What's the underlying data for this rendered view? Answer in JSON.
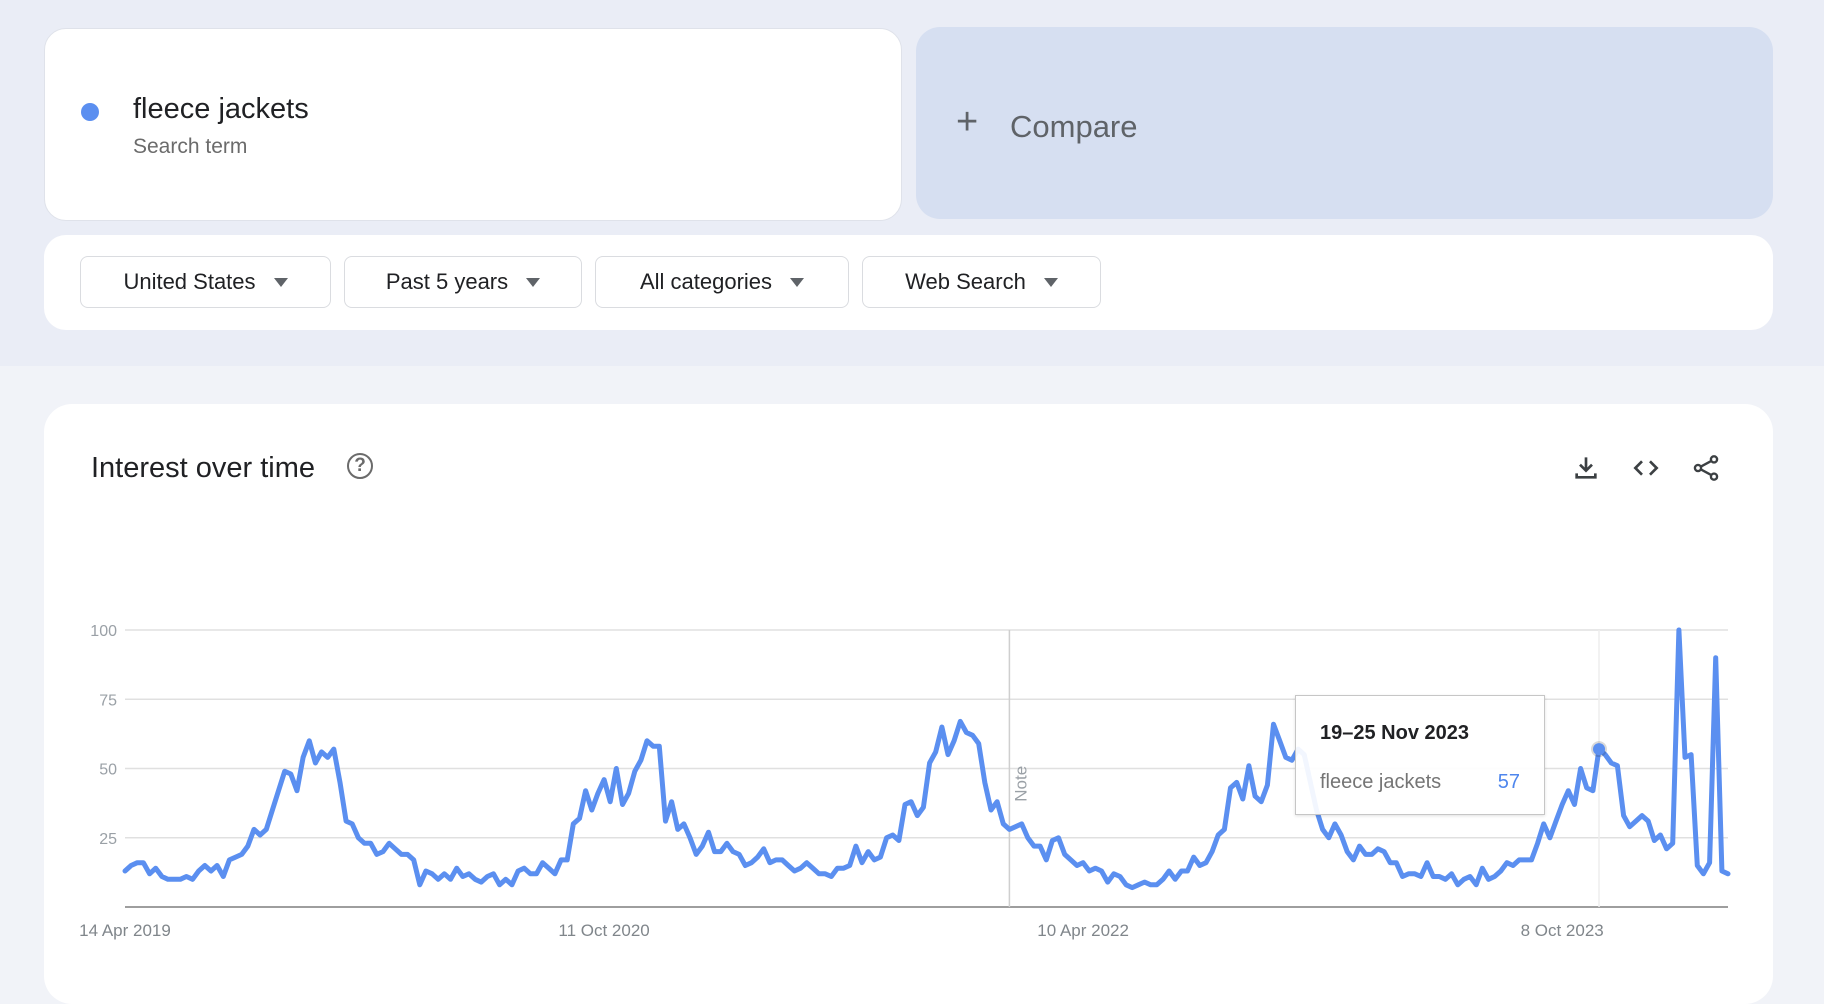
{
  "search": {
    "term": "fleece jackets",
    "term_type": "Search term",
    "term_color": "#5b8ff0",
    "compare_icon": "plus-icon",
    "compare_label": "Compare"
  },
  "filters": [
    {
      "label": "United States",
      "icon": "caret-down-icon"
    },
    {
      "label": "Past 5 years",
      "icon": "caret-down-icon"
    },
    {
      "label": "All categories",
      "icon": "caret-down-icon"
    },
    {
      "label": "Web Search",
      "icon": "caret-down-icon"
    }
  ],
  "widget": {
    "title": "Interest over time",
    "help_icon": "?",
    "tools": [
      "download-icon",
      "embed-code-icon",
      "share-icon"
    ]
  },
  "tooltip": {
    "date": "19–25 Nov 2023",
    "term": "fleece jackets",
    "value": "57"
  },
  "chart_data": {
    "type": "line",
    "title": "Interest over time",
    "xlabel": "",
    "ylabel": "",
    "ylim": [
      0,
      100
    ],
    "y_ticks": [
      100,
      75,
      50,
      25
    ],
    "x_tick_labels": [
      {
        "label": "14 Apr 2019",
        "week": 0
      },
      {
        "label": "11 Oct 2020",
        "week": 78
      },
      {
        "label": "10 Apr 2022",
        "week": 156
      },
      {
        "label": "8 Oct 2023",
        "week": 234
      }
    ],
    "grid": true,
    "legend": "none",
    "annotations": [
      {
        "label": "Note",
        "week": 144
      }
    ],
    "highlight": {
      "week": 240,
      "label": "19–25 Nov 2023",
      "value": 57
    },
    "line_color": "#5b8ff0",
    "series": [
      {
        "name": "fleece jackets",
        "values": [
          13,
          15,
          16,
          16,
          12,
          14,
          11,
          10,
          10,
          10,
          11,
          10,
          13,
          15,
          13,
          15,
          11,
          17,
          18,
          19,
          22,
          28,
          26,
          28,
          35,
          42,
          49,
          48,
          42,
          54,
          60,
          52,
          56,
          54,
          57,
          45,
          31,
          30,
          25,
          23,
          23,
          19,
          20,
          23,
          21,
          19,
          19,
          17,
          8,
          13,
          12,
          10,
          12,
          10,
          14,
          11,
          12,
          10,
          9,
          11,
          12,
          8,
          10,
          8,
          13,
          14,
          12,
          12,
          16,
          14,
          12,
          17,
          17,
          30,
          32,
          42,
          35,
          41,
          46,
          38,
          50,
          37,
          41,
          49,
          53,
          60,
          58,
          58,
          31,
          38,
          28,
          30,
          25,
          19,
          22,
          27,
          20,
          20,
          23,
          20,
          19,
          15,
          16,
          18,
          21,
          16,
          17,
          17,
          15,
          13,
          14,
          16,
          14,
          12,
          12,
          11,
          14,
          14,
          15,
          22,
          16,
          20,
          17,
          18,
          25,
          26,
          24,
          37,
          38,
          33,
          36,
          52,
          56,
          65,
          55,
          60,
          67,
          63,
          62,
          59,
          45,
          35,
          38,
          30,
          28,
          29,
          30,
          25,
          22,
          22,
          17,
          24,
          25,
          19,
          17,
          15,
          16,
          13,
          14,
          13,
          9,
          12,
          11,
          8,
          7,
          8,
          9,
          8,
          8,
          10,
          13,
          10,
          13,
          13,
          18,
          15,
          16,
          20,
          26,
          28,
          43,
          45,
          39,
          51,
          40,
          38,
          44,
          66,
          60,
          54,
          53,
          57,
          55,
          45,
          35,
          28,
          25,
          30,
          26,
          20,
          17,
          22,
          19,
          19,
          21,
          20,
          16,
          16,
          11,
          12,
          12,
          11,
          16,
          11,
          11,
          10,
          12,
          8,
          10,
          11,
          8,
          14,
          10,
          11,
          13,
          16,
          15,
          17,
          17,
          17,
          23,
          30,
          25,
          31,
          37,
          42,
          37,
          50,
          43,
          42,
          57,
          55,
          52,
          51,
          33,
          29,
          31,
          33,
          31,
          24,
          26,
          21,
          23,
          100,
          54,
          55,
          15,
          12,
          16,
          90,
          13,
          12
        ]
      }
    ]
  }
}
